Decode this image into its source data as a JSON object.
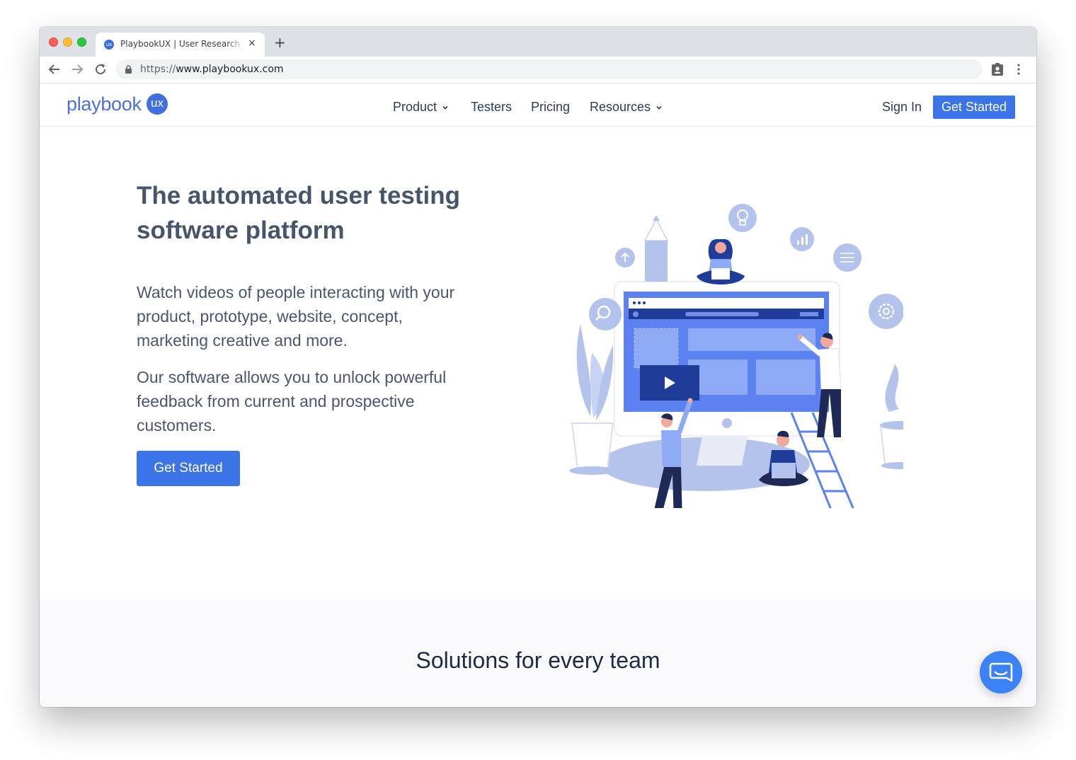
{
  "browser": {
    "tab_title": "PlaybookUX | User Research Software",
    "favicon_label": "ux",
    "tab_close_icon": "×",
    "new_tab_icon": "+",
    "url_scheme": "https://",
    "url_host": "www.playbookux.com"
  },
  "site": {
    "logo": {
      "text": "playbook",
      "badge": "ux"
    },
    "nav": {
      "product": "Product",
      "testers": "Testers",
      "pricing": "Pricing",
      "resources": "Resources"
    },
    "sign_in": "Sign In",
    "get_started": "Get Started"
  },
  "hero": {
    "title": "The automated user testing software platform",
    "paragraph1": "Watch videos of people interacting with your product, prototype, website, concept, marketing creative and more.",
    "paragraph2": "Our software allows you to unlock powerful feedback from current and prospective customers.",
    "cta": "Get Started"
  },
  "solutions": {
    "title": "Solutions for every team"
  },
  "colors": {
    "accent": "#3b73e8",
    "illustration_primary": "#5b82f0",
    "illustration_light": "#b4c3ec",
    "text": "#475569"
  }
}
